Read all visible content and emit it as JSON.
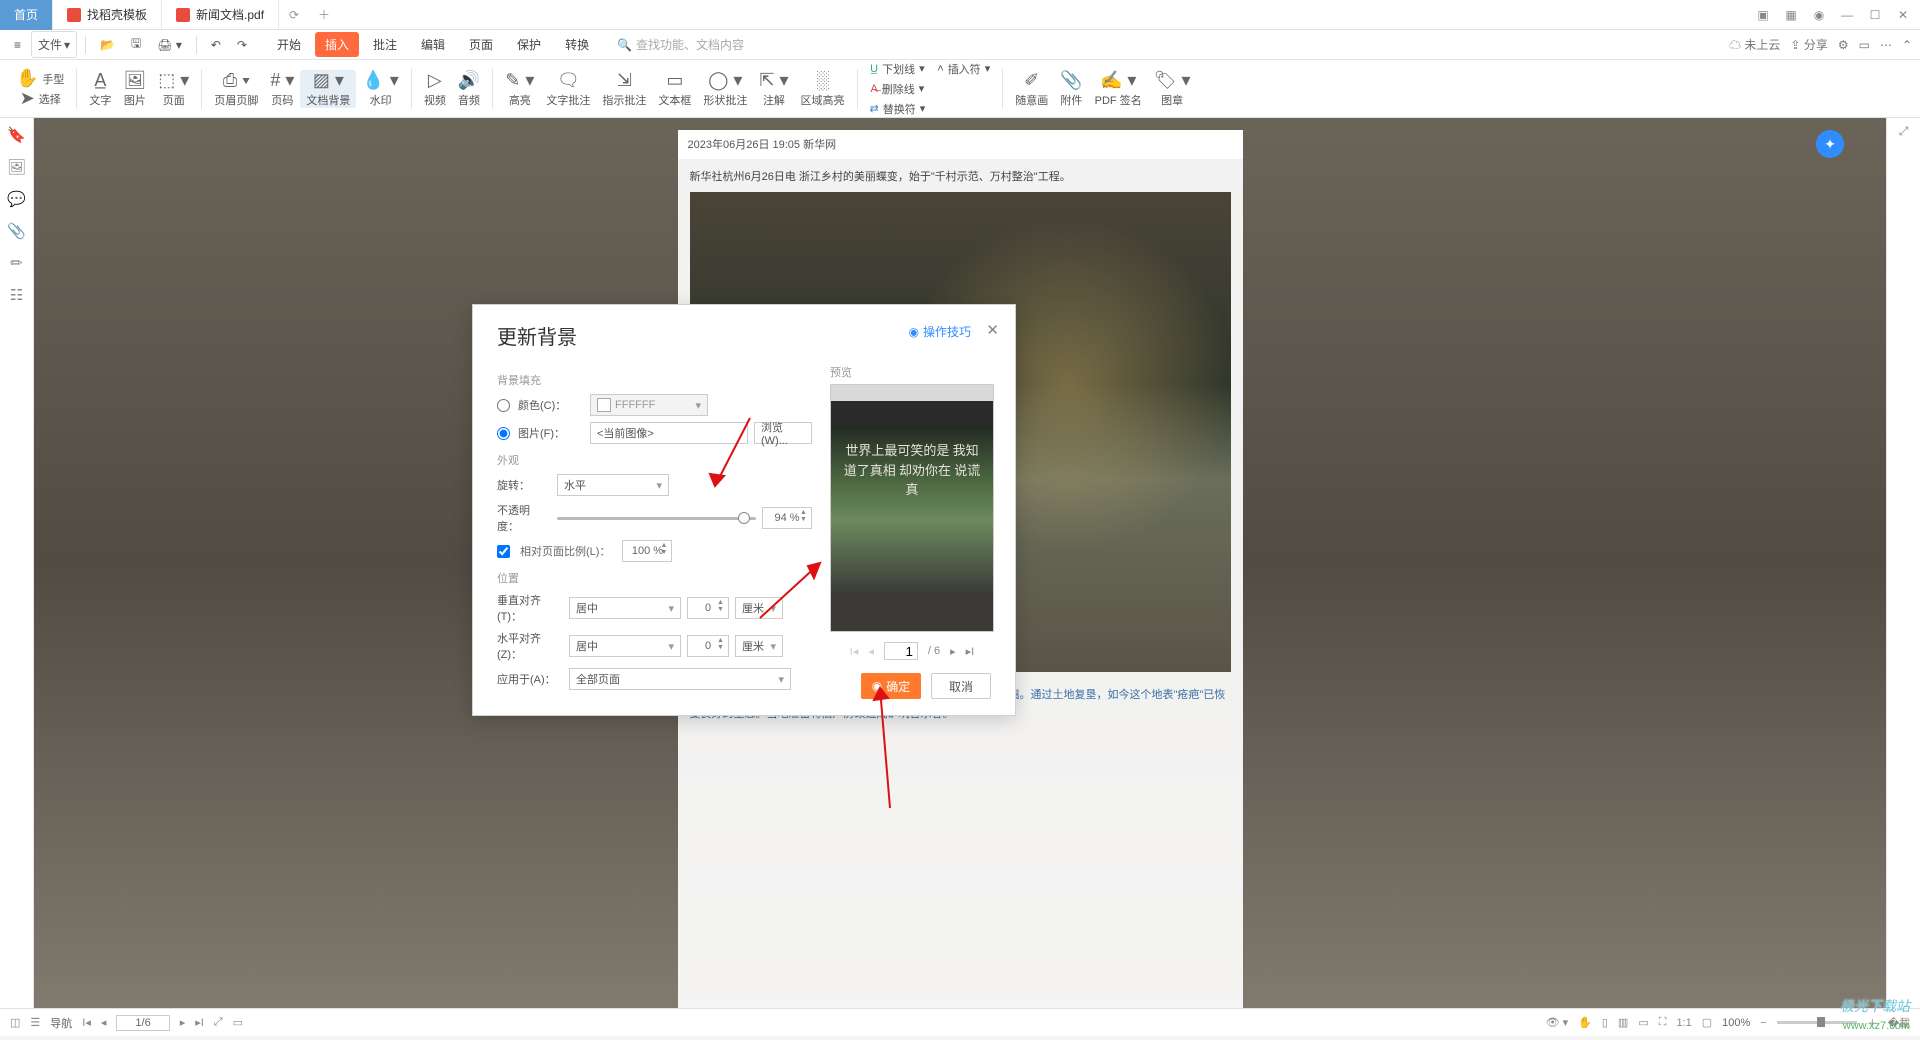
{
  "titlebar": {
    "tab_home": "首页",
    "tab_template": "找稻壳模板",
    "tab_doc": "新闻文档.pdf"
  },
  "menubar": {
    "file": "文件",
    "tabs": [
      "开始",
      "插入",
      "批注",
      "编辑",
      "页面",
      "保护",
      "转换"
    ],
    "active_tab_index": 1,
    "search_placeholder": "查找功能、文档内容",
    "cloud": "未上云",
    "share": "分享"
  },
  "ribbon": {
    "hand": "手型",
    "select": "选择",
    "items": [
      "文字",
      "图片",
      "页面",
      "页眉页脚",
      "页码",
      "文档背景",
      "水印",
      "视频",
      "音频",
      "高亮",
      "文字批注",
      "指示批注",
      "文本框",
      "形状批注",
      "注解",
      "区域高亮"
    ],
    "selected_index": 5,
    "line_group": [
      "下划线",
      "删除线",
      "替换符"
    ],
    "insert_label": "插入符",
    "tail": [
      "随意画",
      "附件",
      "PDF 签名",
      "图章"
    ]
  },
  "page": {
    "header": "2023年06月26日 19:05   新华网",
    "line1": "新华社杭州6月26日电    浙江乡村的美丽蝶变，始于\"千村示范、万村整治\"工程。",
    "caption": "图说：过去这里是余村废弃多年的老旧水泥厂房，厂房周围满目疮痍。通过土地复垦，如今这个地表\"疮疤\"已恢复良好的生态。当地准备将旧厂房改造成矿坑音乐谷。"
  },
  "dialog": {
    "title": "更新背景",
    "help": "操作技巧",
    "sect_fill": "背景填充",
    "color_label": "颜色(C)：",
    "color_value": "FFFFFF",
    "image_label": "图片(F)：",
    "image_value": "<当前图像>",
    "browse": "浏览(W)...",
    "sect_appear": "外观",
    "rotate_label": "旋转：",
    "rotate_value": "水平",
    "opacity_label": "不透明度：",
    "opacity_value": "94 %",
    "scale_chk": "相对页面比例(L)：",
    "scale_value": "100 %",
    "sect_pos": "位置",
    "valign_label": "垂直对齐(T)：",
    "valign_value": "居中",
    "halign_label": "水平对齐(Z)：",
    "halign_value": "居中",
    "offset_v": "0",
    "offset_h": "0",
    "unit": "厘米",
    "apply_label": "应用于(A)：",
    "apply_value": "全部页面",
    "preview_label": "预览",
    "preview_text": "世界上最可笑的是\n我知道了真相\n却劝你在\n说谎\n真",
    "page_current": "1",
    "page_total": "/ 6",
    "ok": "确定",
    "cancel": "取消"
  },
  "statusbar": {
    "nav_label": "导航",
    "page": "1/6",
    "zoom": "100%"
  }
}
